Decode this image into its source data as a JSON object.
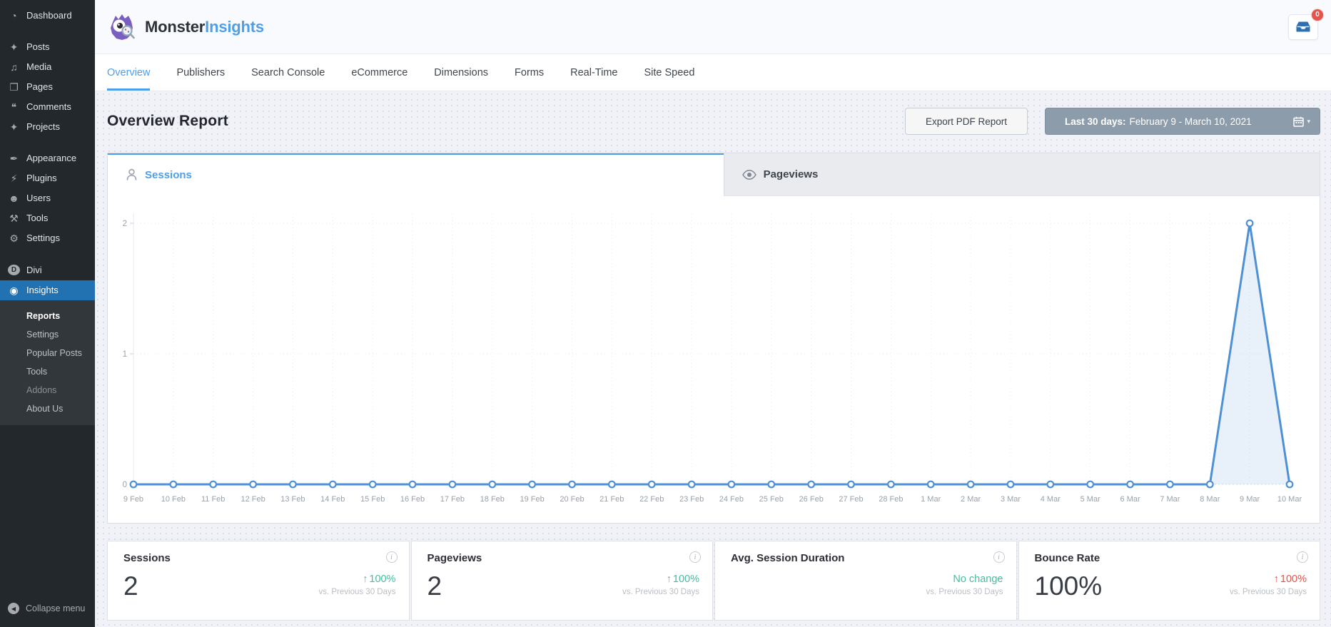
{
  "colors": {
    "accent_blue": "#4f9ee8",
    "chart_line": "#4e90d6",
    "chart_fill": "rgba(79,148,220,0.13)",
    "grid_line": "#e5eaf2",
    "axis_text": "#9aa1a9",
    "positive": "#46bda2",
    "negative": "#e5544c",
    "wp_active_blue": "#2271b1",
    "date_button_bg": "#8c9cab",
    "badge_red": "#e5544c"
  },
  "sidebar": {
    "menu": [
      {
        "label": "Dashboard",
        "icon": "dashboard-icon",
        "gap_after": true
      },
      {
        "label": "Posts",
        "icon": "pushpin-icon"
      },
      {
        "label": "Media",
        "icon": "media-icon"
      },
      {
        "label": "Pages",
        "icon": "pages-icon"
      },
      {
        "label": "Comments",
        "icon": "comments-icon"
      },
      {
        "label": "Projects",
        "icon": "pushpin-icon",
        "gap_after": true
      },
      {
        "label": "Appearance",
        "icon": "appearance-icon"
      },
      {
        "label": "Plugins",
        "icon": "plugins-icon"
      },
      {
        "label": "Users",
        "icon": "users-icon"
      },
      {
        "label": "Tools",
        "icon": "tools-icon"
      },
      {
        "label": "Settings",
        "icon": "settings-icon",
        "gap_after": true
      },
      {
        "label": "Divi",
        "icon": "divi-icon"
      },
      {
        "label": "Insights",
        "icon": "insights-icon",
        "active": true
      }
    ],
    "submenu": [
      {
        "label": "Reports",
        "current": true
      },
      {
        "label": "Settings"
      },
      {
        "label": "Popular Posts"
      },
      {
        "label": "Tools"
      },
      {
        "label": "Addons",
        "dim": true
      },
      {
        "label": "About Us"
      }
    ],
    "collapse_label": "Collapse menu"
  },
  "header": {
    "brand_monster": "Monster",
    "brand_insights": "Insights",
    "inbox_badge": "0"
  },
  "nav_tabs": {
    "active": "Overview",
    "items": [
      "Overview",
      "Publishers",
      "Search Console",
      "eCommerce",
      "Dimensions",
      "Forms",
      "Real-Time",
      "Site Speed"
    ]
  },
  "report": {
    "title": "Overview Report",
    "export_button": "Export PDF Report",
    "date_prefix": "Last 30 days:",
    "date_range": "February 9 - March 10, 2021"
  },
  "chart_tabs": {
    "sessions": "Sessions",
    "pageviews": "Pageviews"
  },
  "chart_data": {
    "type": "line",
    "title": "Sessions",
    "x": [
      "9 Feb",
      "10 Feb",
      "11 Feb",
      "12 Feb",
      "13 Feb",
      "14 Feb",
      "15 Feb",
      "16 Feb",
      "17 Feb",
      "18 Feb",
      "19 Feb",
      "20 Feb",
      "21 Feb",
      "22 Feb",
      "23 Feb",
      "24 Feb",
      "25 Feb",
      "26 Feb",
      "27 Feb",
      "28 Feb",
      "1 Mar",
      "2 Mar",
      "3 Mar",
      "4 Mar",
      "5 Mar",
      "6 Mar",
      "7 Mar",
      "8 Mar",
      "9 Mar",
      "10 Mar"
    ],
    "values": [
      0,
      0,
      0,
      0,
      0,
      0,
      0,
      0,
      0,
      0,
      0,
      0,
      0,
      0,
      0,
      0,
      0,
      0,
      0,
      0,
      0,
      0,
      0,
      0,
      0,
      0,
      0,
      0,
      2,
      0
    ],
    "ylim": [
      0,
      2
    ],
    "yticks": [
      0,
      1,
      2
    ],
    "grid": "vertical-dotted",
    "legend": "none",
    "marker": "circle"
  },
  "stats": {
    "cards": [
      {
        "title": "Sessions",
        "value": "2",
        "change": "100%",
        "direction": "up",
        "trend": "positive",
        "note": "vs. Previous 30 Days"
      },
      {
        "title": "Pageviews",
        "value": "2",
        "change": "100%",
        "direction": "up",
        "trend": "positive",
        "note": "vs. Previous 30 Days"
      },
      {
        "title": "Avg. Session Duration",
        "value": "",
        "change": "No change",
        "direction": "none",
        "trend": "positive",
        "note": "vs. Previous 30 Days"
      },
      {
        "title": "Bounce Rate",
        "value": "100%",
        "change": "100%",
        "direction": "up",
        "trend": "negative",
        "note": "vs. Previous 30 Days"
      }
    ]
  }
}
